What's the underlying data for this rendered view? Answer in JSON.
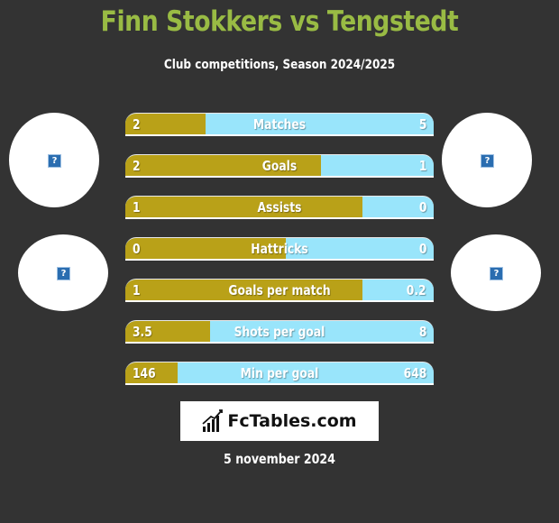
{
  "header": {
    "title": "Finn Stokkers vs Tengstedt",
    "subtitle": "Club competitions, Season 2024/2025"
  },
  "badges": [
    {
      "icon": "broken-image-icon",
      "glyph": "?"
    },
    {
      "icon": "broken-image-icon",
      "glyph": "?"
    },
    {
      "icon": "broken-image-icon",
      "glyph": "?"
    },
    {
      "icon": "broken-image-icon",
      "glyph": "?"
    }
  ],
  "colors": {
    "left_bar": "#b9a118",
    "right_bar": "#99e5fb",
    "title": "#99bb44",
    "background": "#333333"
  },
  "stats": [
    {
      "label": "Matches",
      "left": "2",
      "right": "5",
      "left_fraction": 0.26
    },
    {
      "label": "Goals",
      "left": "2",
      "right": "1",
      "left_fraction": 0.635
    },
    {
      "label": "Assists",
      "left": "1",
      "right": "0",
      "left_fraction": 0.77
    },
    {
      "label": "Hattricks",
      "left": "0",
      "right": "0",
      "left_fraction": 0.52
    },
    {
      "label": "Goals per match",
      "left": "1",
      "right": "0.2",
      "left_fraction": 0.77
    },
    {
      "label": "Shots per goal",
      "left": "3.5",
      "right": "8",
      "left_fraction": 0.275
    },
    {
      "label": "Min per goal",
      "left": "146",
      "right": "648",
      "left_fraction": 0.17
    }
  ],
  "footer": {
    "logo_text": "FcTables.com",
    "logo_icon": "bar-chart-icon",
    "date": "5 november 2024"
  }
}
